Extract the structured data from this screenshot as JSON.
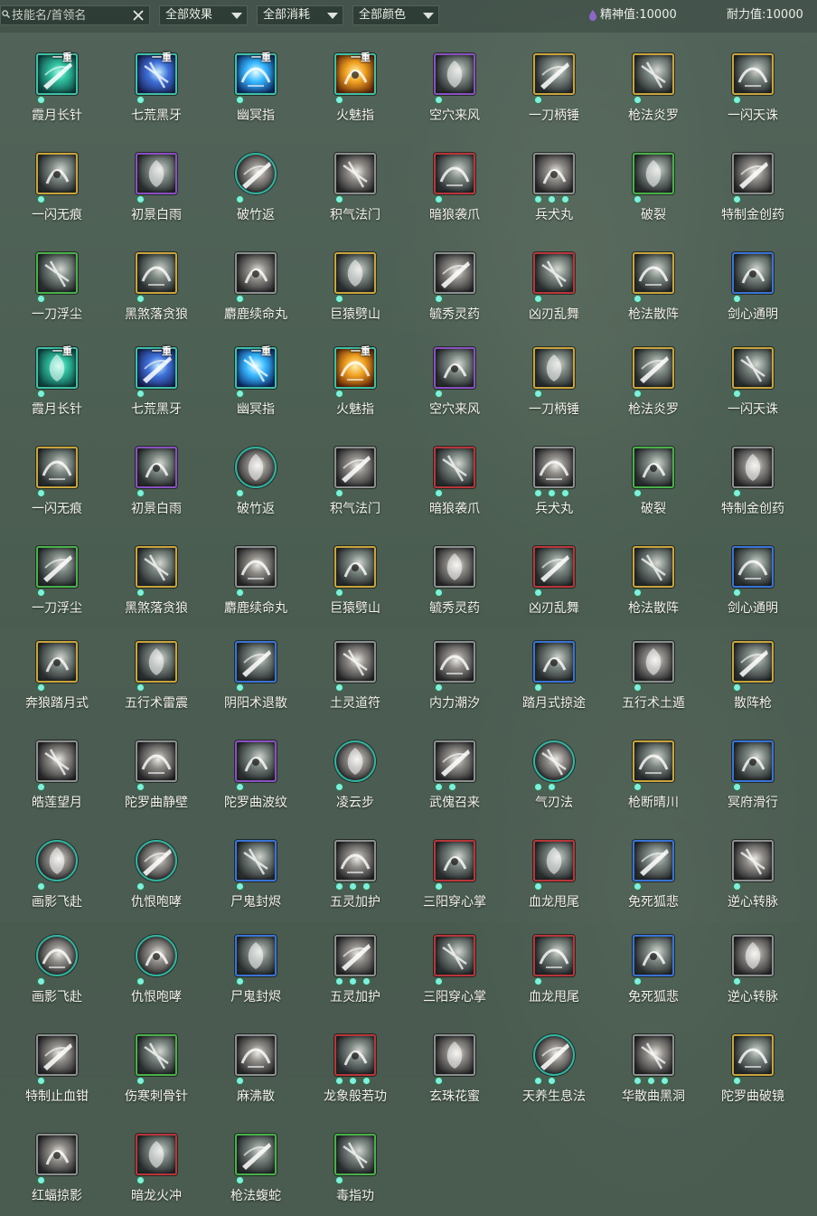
{
  "toolbar": {
    "search_placeholder": "技能名/首领名",
    "filters": [
      {
        "label": "全部效果"
      },
      {
        "label": "全部消耗"
      },
      {
        "label": "全部颜色"
      }
    ],
    "stats": [
      {
        "label": "精神值:10000",
        "icon": "spirit-drop-icon"
      },
      {
        "label": "耐力值:10000",
        "icon": "stamina-crescent-icon"
      }
    ]
  },
  "skills": [
    {
      "name": "霞月长针",
      "color": "teal",
      "tier": "一重",
      "dots": 1
    },
    {
      "name": "七荒黑牙",
      "color": "teal",
      "tier": "一重",
      "dots": 1
    },
    {
      "name": "幽冥指",
      "color": "teal",
      "tier": "一重",
      "dots": 1
    },
    {
      "name": "火魅指",
      "color": "teal",
      "tier": "一重",
      "dots": 1
    },
    {
      "name": "空穴来风",
      "color": "purple",
      "dots": 1
    },
    {
      "name": "一刀柄锤",
      "color": "gold",
      "dots": 1
    },
    {
      "name": "枪法炎罗",
      "color": "gold",
      "dots": 1
    },
    {
      "name": "一闪天诛",
      "color": "gold",
      "dots": 1
    },
    {
      "name": "一闪无痕",
      "color": "gold",
      "dots": 1
    },
    {
      "name": "初景白雨",
      "color": "purple",
      "dots": 1
    },
    {
      "name": "破竹返",
      "color": "round",
      "dots": 1
    },
    {
      "name": "积气法门",
      "color": "gray",
      "dots": 1
    },
    {
      "name": "暗狼袭爪",
      "color": "red",
      "dots": 1
    },
    {
      "name": "兵犬丸",
      "color": "gray",
      "dots": 3
    },
    {
      "name": "破裂",
      "color": "green",
      "dots": 1
    },
    {
      "name": "特制金创药",
      "color": "gray",
      "dots": 1
    },
    {
      "name": "一刀浮尘",
      "color": "green",
      "dots": 1
    },
    {
      "name": "黑煞落贪狼",
      "color": "gold",
      "dots": 1
    },
    {
      "name": "麝鹿续命丸",
      "color": "gray",
      "dots": 1
    },
    {
      "name": "巨猿劈山",
      "color": "gold",
      "dots": 1
    },
    {
      "name": "毓秀灵药",
      "color": "gray",
      "dots": 1
    },
    {
      "name": "凶刃乱舞",
      "color": "red",
      "dots": 1
    },
    {
      "name": "枪法散阵",
      "color": "gold",
      "dots": 1
    },
    {
      "name": "剑心通明",
      "color": "blue",
      "dots": 1
    },
    {
      "name": "霞月长针",
      "color": "teal",
      "tier": "一重",
      "dots": 1
    },
    {
      "name": "七荒黑牙",
      "color": "teal",
      "tier": "一重",
      "dots": 1
    },
    {
      "name": "幽冥指",
      "color": "teal",
      "tier": "一重",
      "dots": 1
    },
    {
      "name": "火魅指",
      "color": "teal",
      "tier": "一重",
      "dots": 1
    },
    {
      "name": "空穴来风",
      "color": "purple",
      "dots": 1
    },
    {
      "name": "一刀柄锤",
      "color": "gold",
      "dots": 1
    },
    {
      "name": "枪法炎罗",
      "color": "gold",
      "dots": 1
    },
    {
      "name": "一闪天诛",
      "color": "gold",
      "dots": 1
    },
    {
      "name": "一闪无痕",
      "color": "gold",
      "dots": 1
    },
    {
      "name": "初景白雨",
      "color": "purple",
      "dots": 1
    },
    {
      "name": "破竹返",
      "color": "round",
      "dots": 1
    },
    {
      "name": "积气法门",
      "color": "gray",
      "dots": 1
    },
    {
      "name": "暗狼袭爪",
      "color": "red",
      "dots": 1
    },
    {
      "name": "兵犬丸",
      "color": "gray",
      "dots": 3
    },
    {
      "name": "破裂",
      "color": "green",
      "dots": 1
    },
    {
      "name": "特制金创药",
      "color": "gray",
      "dots": 1
    },
    {
      "name": "一刀浮尘",
      "color": "green",
      "dots": 1
    },
    {
      "name": "黑煞落贪狼",
      "color": "gold",
      "dots": 1
    },
    {
      "name": "麝鹿续命丸",
      "color": "gray",
      "dots": 1
    },
    {
      "name": "巨猿劈山",
      "color": "gold",
      "dots": 1
    },
    {
      "name": "毓秀灵药",
      "color": "gray",
      "dots": 1
    },
    {
      "name": "凶刃乱舞",
      "color": "red",
      "dots": 1
    },
    {
      "name": "枪法散阵",
      "color": "gold",
      "dots": 1
    },
    {
      "name": "剑心通明",
      "color": "blue",
      "dots": 1
    },
    {
      "name": "奔狼踏月式",
      "color": "gold",
      "dots": 1
    },
    {
      "name": "五行术雷震",
      "color": "gold",
      "dots": 1
    },
    {
      "name": "阴阳术退散",
      "color": "blue",
      "dots": 1
    },
    {
      "name": "土灵道符",
      "color": "gray",
      "dots": 1
    },
    {
      "name": "内力潮汐",
      "color": "gray",
      "dots": 1
    },
    {
      "name": "踏月式掠途",
      "color": "blue",
      "dots": 1
    },
    {
      "name": "五行术土遁",
      "color": "gray",
      "dots": 1
    },
    {
      "name": "散阵枪",
      "color": "gold",
      "dots": 1
    },
    {
      "name": "皓莲望月",
      "color": "gray",
      "dots": 1
    },
    {
      "name": "陀罗曲静壁",
      "color": "gray",
      "dots": 1
    },
    {
      "name": "陀罗曲波纹",
      "color": "purple",
      "dots": 1
    },
    {
      "name": "凌云步",
      "color": "round",
      "dots": 1
    },
    {
      "name": "武傀召来",
      "color": "gray",
      "dots": 2
    },
    {
      "name": "气刃法",
      "color": "round",
      "dots": 2
    },
    {
      "name": "枪断晴川",
      "color": "gold",
      "dots": 1
    },
    {
      "name": "冥府滑行",
      "color": "blue",
      "dots": 1
    },
    {
      "name": "画影飞赴",
      "color": "round",
      "dots": 1
    },
    {
      "name": "仇恨咆哮",
      "color": "round",
      "dots": 1
    },
    {
      "name": "尸鬼封烬",
      "color": "blue",
      "dots": 1
    },
    {
      "name": "五灵加护",
      "color": "gray",
      "dots": 3
    },
    {
      "name": "三阳穿心掌",
      "color": "red",
      "dots": 1
    },
    {
      "name": "血龙甩尾",
      "color": "red",
      "dots": 1
    },
    {
      "name": "免死狐悲",
      "color": "blue",
      "dots": 1
    },
    {
      "name": "逆心转脉",
      "color": "gray",
      "dots": 1
    },
    {
      "name": "画影飞赴",
      "color": "round",
      "dots": 1
    },
    {
      "name": "仇恨咆哮",
      "color": "round",
      "dots": 1
    },
    {
      "name": "尸鬼封烬",
      "color": "blue",
      "dots": 1
    },
    {
      "name": "五灵加护",
      "color": "gray",
      "dots": 3
    },
    {
      "name": "三阳穿心掌",
      "color": "red",
      "dots": 1
    },
    {
      "name": "血龙甩尾",
      "color": "red",
      "dots": 1
    },
    {
      "name": "免死狐悲",
      "color": "blue",
      "dots": 1
    },
    {
      "name": "逆心转脉",
      "color": "gray",
      "dots": 1
    },
    {
      "name": "特制止血钳",
      "color": "gray",
      "dots": 1
    },
    {
      "name": "伤寒刺骨针",
      "color": "green",
      "dots": 1
    },
    {
      "name": "麻沸散",
      "color": "gray",
      "dots": 1
    },
    {
      "name": "龙象般若功",
      "color": "red",
      "dots": 3
    },
    {
      "name": "玄珠花蜜",
      "color": "gray",
      "dots": 1
    },
    {
      "name": "天养生息法",
      "color": "round",
      "dots": 2
    },
    {
      "name": "华散曲黑洞",
      "color": "gray",
      "dots": 3
    },
    {
      "name": "陀罗曲破镜",
      "color": "gold",
      "dots": 1
    },
    {
      "name": "红蝠掠影",
      "color": "gray",
      "dots": 1
    },
    {
      "name": "暗龙火冲",
      "color": "red",
      "dots": 1
    },
    {
      "name": "枪法蝮蛇",
      "color": "green",
      "dots": 1
    },
    {
      "name": "毒指功",
      "color": "green",
      "dots": 1
    }
  ]
}
